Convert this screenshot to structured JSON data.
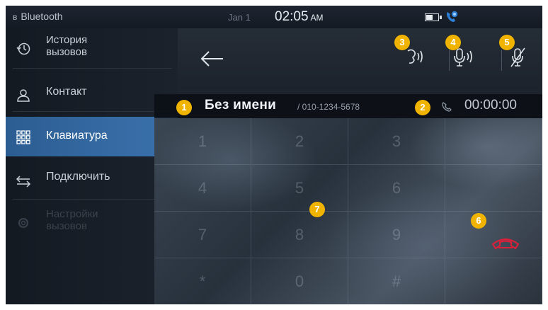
{
  "status_bar": {
    "bluetooth_label": "Bluetooth",
    "date": "Jan 1",
    "time": "02:05",
    "ampm": "AM",
    "icons": [
      "battery-icon",
      "phone-call-icon"
    ]
  },
  "sidebar": {
    "items": [
      {
        "label_line1": "История",
        "label_line2": "вызовов",
        "icon": "history-icon",
        "state": "normal"
      },
      {
        "label": "Контакт",
        "icon": "contact-icon",
        "state": "normal"
      },
      {
        "label": "Клавиатура",
        "icon": "keypad-icon",
        "state": "active"
      },
      {
        "label": "Подключить",
        "icon": "connect-arrows-icon",
        "state": "normal"
      },
      {
        "label_line1": "Настройки",
        "label_line2": "вызовов",
        "icon": "settings-icon",
        "state": "disabled"
      }
    ]
  },
  "toolbar": {
    "icons": [
      "back-arrow-icon",
      "private-mode-icon",
      "mic-volume-icon",
      "mic-mute-icon"
    ]
  },
  "caller": {
    "name": "Без имени",
    "number": "/ 010-1234-5678",
    "duration": "00:00:00"
  },
  "keypad": {
    "keys": [
      "1",
      "2",
      "3",
      "",
      "4",
      "5",
      "6",
      "",
      "7",
      "8",
      "9",
      "",
      "*",
      "0",
      "#",
      ""
    ]
  },
  "callouts": [
    "1",
    "2",
    "3",
    "4",
    "5",
    "6",
    "7"
  ],
  "colors": {
    "active_item": "#3b72ad",
    "callout": "#f0b400",
    "end_call": "#d9213a"
  }
}
